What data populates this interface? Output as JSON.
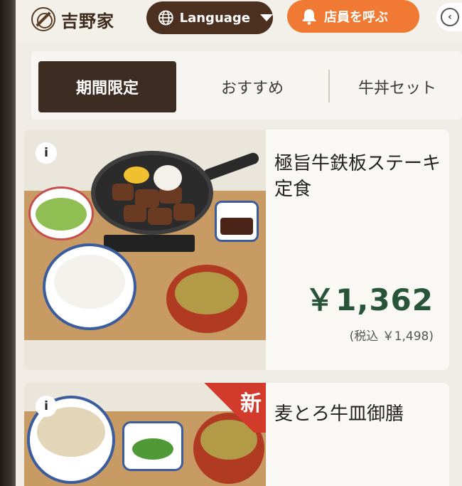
{
  "header": {
    "brand": "吉野家",
    "language_label": "Language",
    "call_staff_label": "店員を呼ぶ"
  },
  "tabs": [
    {
      "label": "期間限定",
      "active": true
    },
    {
      "label": "おすすめ",
      "active": false
    },
    {
      "label": "牛丼セット",
      "active": false
    }
  ],
  "menu": [
    {
      "info": "i",
      "name": "極旨牛鉄板ステーキ定食",
      "price": "￥1,362",
      "price_tax": "(税込 ￥1,498)"
    },
    {
      "info": "i",
      "badge": "新",
      "name": "麦とろ牛皿御膳"
    }
  ],
  "colors": {
    "brown": "#4b2f1f",
    "orange": "#f07a33",
    "price_green": "#28543a",
    "new_red": "#d23a2c"
  },
  "icons": [
    "globe-icon",
    "bell-icon",
    "back-icon",
    "info-icon"
  ]
}
